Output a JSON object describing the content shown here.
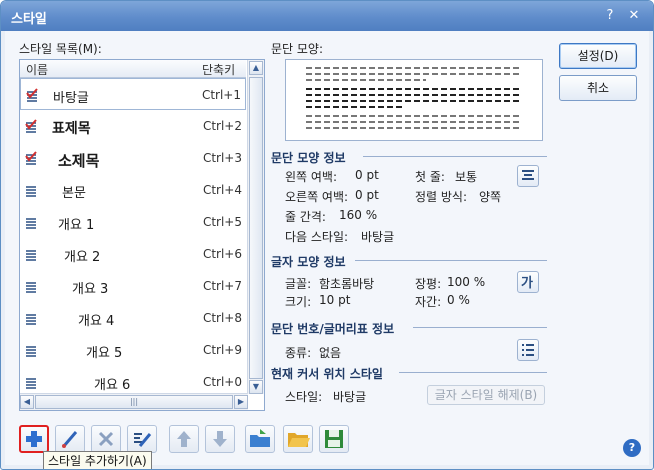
{
  "window": {
    "title": "스타일",
    "help_glyph": "?",
    "close_glyph": "✕"
  },
  "list_label": "스타일 목록(M):",
  "columns": {
    "name": "이름",
    "shortcut": "단축키"
  },
  "styles": [
    {
      "name": "바탕글",
      "shortcut": "Ctrl+1",
      "icon": "paragraph-style-check-icon"
    },
    {
      "name": "표제목",
      "shortcut": "Ctrl+2",
      "icon": "paragraph-style-check-icon"
    },
    {
      "name": "소제목",
      "shortcut": "Ctrl+3",
      "icon": "paragraph-style-check-icon"
    },
    {
      "name": "본문",
      "shortcut": "Ctrl+4",
      "icon": "paragraph-style-icon"
    },
    {
      "name": "개요 1",
      "shortcut": "Ctrl+5",
      "icon": "paragraph-style-icon"
    },
    {
      "name": "개요 2",
      "shortcut": "Ctrl+6",
      "icon": "paragraph-style-icon"
    },
    {
      "name": "개요 3",
      "shortcut": "Ctrl+7",
      "icon": "paragraph-style-icon"
    },
    {
      "name": "개요 4",
      "shortcut": "Ctrl+8",
      "icon": "paragraph-style-icon"
    },
    {
      "name": "개요 5",
      "shortcut": "Ctrl+9",
      "icon": "paragraph-style-icon"
    },
    {
      "name": "개요 6",
      "shortcut": "Ctrl+0",
      "icon": "paragraph-style-icon"
    }
  ],
  "preview_label": "문단 모양:",
  "buttons": {
    "settings": "설정(D)",
    "cancel": "취소"
  },
  "para_info": {
    "title": "문단 모양 정보",
    "left_margin_label": "왼쪽 여백:",
    "left_margin": "0 pt",
    "first_line_label": "첫 줄:",
    "first_line": "보통",
    "right_margin_label": "오른쪽 여백:",
    "right_margin": "0 pt",
    "align_label": "정렬 방식:",
    "align": "양쪽",
    "line_spacing_label": "줄 간격:",
    "line_spacing": "160 %",
    "next_style_label": "다음 스타일:",
    "next_style": "바탕글"
  },
  "char_info": {
    "title": "글자 모양 정보",
    "font_label": "글꼴:",
    "font": "함초롬바탕",
    "width_label": "장평:",
    "width": "100 %",
    "size_label": "크기:",
    "size": "10 pt",
    "spacing_label": "자간:",
    "spacing": "0 %"
  },
  "numbering_info": {
    "title": "문단 번호/글머리표 정보",
    "kind_label": "종류:",
    "kind": "없음"
  },
  "cursor_style": {
    "title": "현재 커서 위치 스타일",
    "style_label": "스타일:",
    "style": "바탕글",
    "release_button": "글자 스타일 해제(B)"
  },
  "tooltip": "스타일 추가하기(A)",
  "colors": {
    "accent": "#2f6cc3",
    "title_bar": "#5f8ccb",
    "highlight": "#e02020"
  }
}
